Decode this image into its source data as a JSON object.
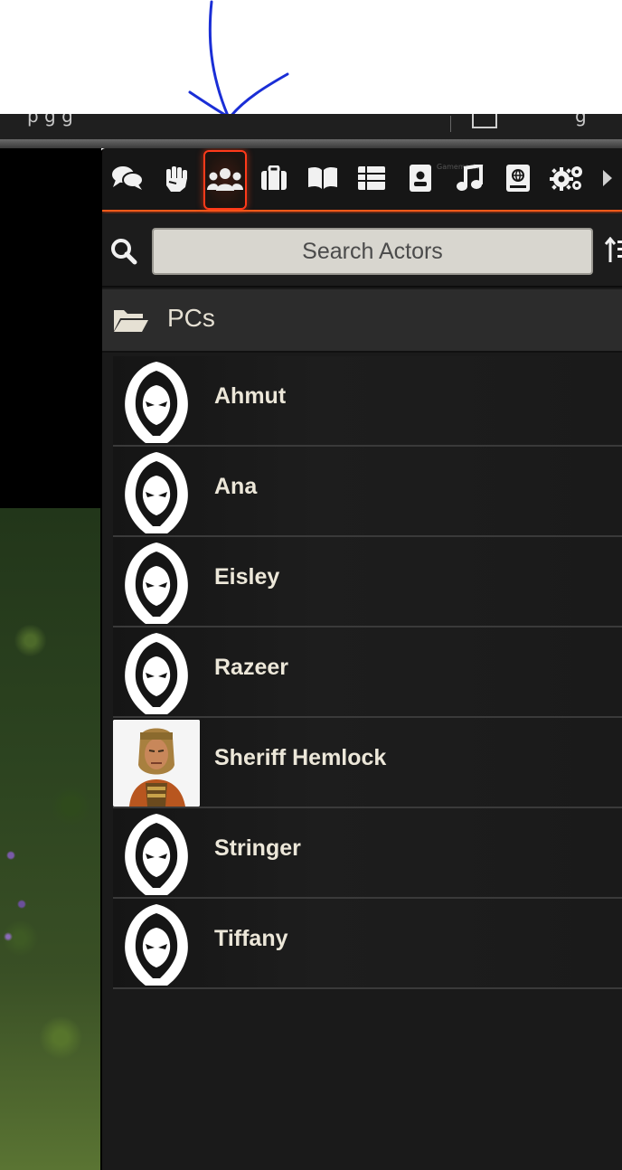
{
  "topbar": {
    "fragment_left": "p  g    g",
    "fragment_right": "g"
  },
  "sidebar": {
    "tabs": [
      {
        "icon": "chat-icon",
        "active": false
      },
      {
        "icon": "fist-icon",
        "active": false
      },
      {
        "icon": "users-icon",
        "active": true
      },
      {
        "icon": "suitcase-icon",
        "active": false
      },
      {
        "icon": "book-icon",
        "active": false
      },
      {
        "icon": "table-icon",
        "active": false
      },
      {
        "icon": "id-card-icon",
        "active": false
      },
      {
        "icon": "music-icon",
        "active": false
      },
      {
        "icon": "compendium-icon",
        "active": false
      },
      {
        "icon": "gears-icon",
        "active": false
      },
      {
        "icon": "chevron-right-icon",
        "active": false
      }
    ],
    "faint_label": "Gamemaster",
    "search": {
      "placeholder": "Search Actors",
      "value": ""
    },
    "folder": {
      "name": "PCs"
    },
    "actors": [
      {
        "name": "Ahmut",
        "image": "hooded-figure-icon"
      },
      {
        "name": "Ana",
        "image": "hooded-figure-icon"
      },
      {
        "name": "Eisley",
        "image": "hooded-figure-icon"
      },
      {
        "name": "Razeer",
        "image": "hooded-figure-icon"
      },
      {
        "name": "Sheriff Hemlock",
        "image": "portrait"
      },
      {
        "name": "Stringer",
        "image": "hooded-figure-icon"
      },
      {
        "name": "Tiffany",
        "image": "hooded-figure-icon"
      }
    ]
  },
  "colors": {
    "accent": "#ff5a1a",
    "active_border": "#ff3a1a",
    "annotation": "#1a2ed6"
  }
}
